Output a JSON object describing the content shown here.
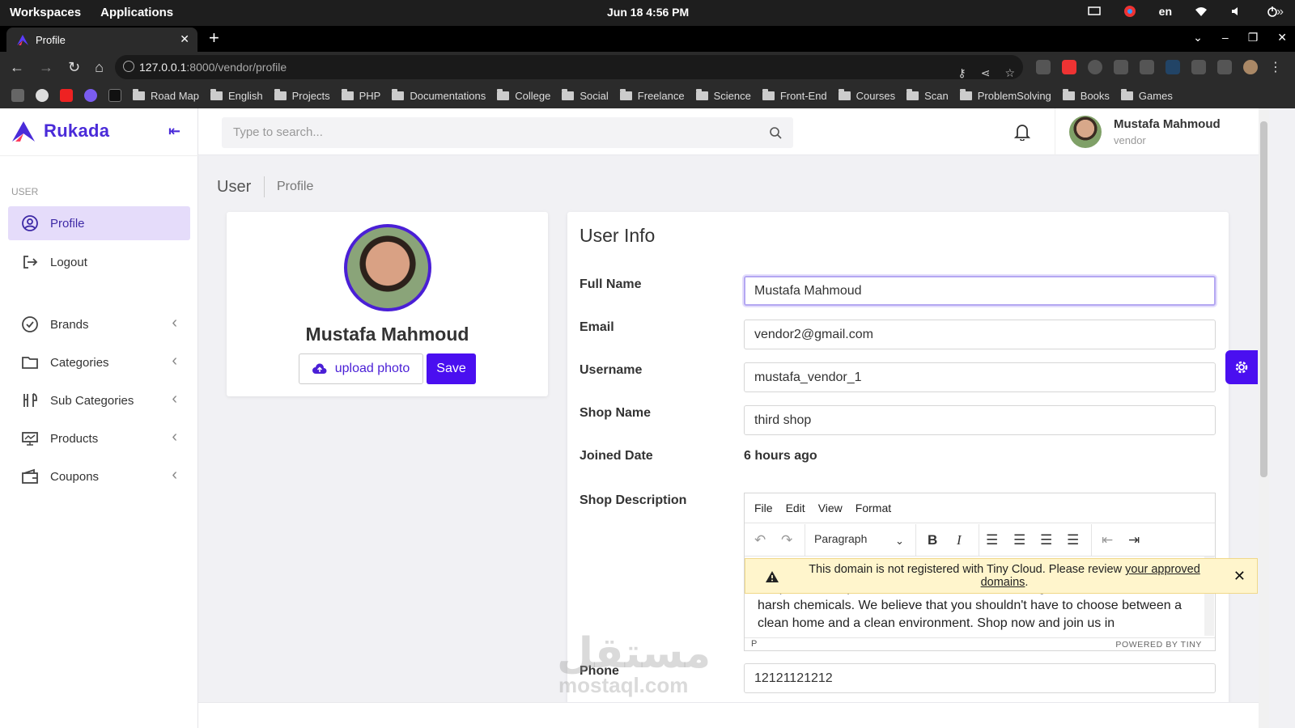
{
  "os": {
    "left_items": [
      "Workspaces",
      "Applications"
    ],
    "clock": "Jun 18  4:56 PM",
    "lang": "en"
  },
  "browser": {
    "tab_title": "Profile",
    "url_host": "127.0.0.1",
    "url_rest": ":8000/vendor/profile",
    "bookmarks": [
      "Road Map",
      "English",
      "Projects",
      "PHP",
      "Documentations",
      "College",
      "Social",
      "Freelance",
      "Science",
      "Front-End",
      "Courses",
      "Scan",
      "ProblemSolving",
      "Books",
      "Games"
    ]
  },
  "app": {
    "brand": "Rukada",
    "section_label": "USER",
    "menu": [
      {
        "label": "Profile",
        "icon": "user-circle-icon",
        "active": true
      },
      {
        "label": "Logout",
        "icon": "logout-icon"
      },
      {
        "label": "Brands",
        "icon": "check-circle-icon"
      },
      {
        "label": "Categories",
        "icon": "folder-icon"
      },
      {
        "label": "Sub Categories",
        "icon": "utensils-icon"
      },
      {
        "label": "Products",
        "icon": "monitor-icon"
      },
      {
        "label": "Coupons",
        "icon": "wallet-icon"
      }
    ],
    "accent": "#4a0ff0"
  },
  "header": {
    "search_placeholder": "Type to search...",
    "user_name": "Mustafa Mahmoud",
    "user_role": "vendor"
  },
  "breadcrumb": {
    "root": "User",
    "current": "Profile"
  },
  "profile_card": {
    "name": "Mustafa Mahmoud",
    "upload_label": "upload photo",
    "save_label": "Save"
  },
  "user_info": {
    "title": "User Info",
    "fields": {
      "full_name_label": "Full Name",
      "full_name": "Mustafa Mahmoud",
      "email_label": "Email",
      "email": "vendor2@gmail.com",
      "username_label": "Username",
      "username": "mustafa_vendor_1",
      "shop_name_label": "Shop Name",
      "shop_name": "third shop",
      "joined_label": "Joined Date",
      "joined": "6 hours ago",
      "desc_label": "Shop Description",
      "phone_label": "Phone",
      "phone": "12121121212"
    },
    "editor": {
      "menu": [
        "File",
        "Edit",
        "View",
        "Format"
      ],
      "block_format": "Paragraph",
      "text": "the planet. Our products are made with natural ingredients and are free from harsh chemicals. We believe that you shouldn't have to choose between a clean home and a clean environment. Shop now and join us in",
      "status_path": "P",
      "powered": "POWERED BY TINY",
      "warning_text": "This domain is not registered with Tiny Cloud. Please review ",
      "warning_link": "your approved domains",
      "warning_end": "."
    }
  },
  "watermark": {
    "ar": "مستقل",
    "en": "mostaql.com"
  }
}
